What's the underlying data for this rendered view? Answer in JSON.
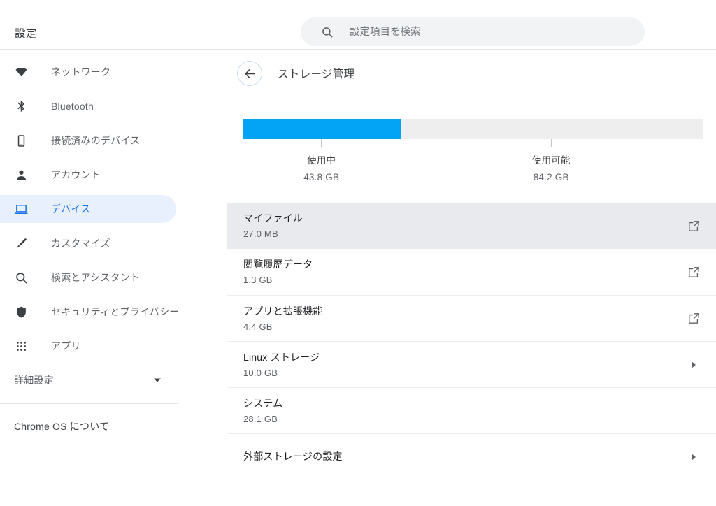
{
  "app": {
    "title": "設定"
  },
  "search": {
    "placeholder": "設定項目を検索",
    "value": "",
    "icon": "search-icon"
  },
  "sidebar": {
    "items": [
      {
        "label": "ネットワーク",
        "icon": "wifi-icon",
        "selected": false
      },
      {
        "label": "Bluetooth",
        "icon": "bluetooth-icon",
        "selected": false
      },
      {
        "label": "接続済みのデバイス",
        "icon": "phone-icon",
        "selected": false
      },
      {
        "label": "アカウント",
        "icon": "person-icon",
        "selected": false
      },
      {
        "label": "デバイス",
        "icon": "laptop-icon",
        "selected": true
      },
      {
        "label": "カスタマイズ",
        "icon": "brush-icon",
        "selected": false
      },
      {
        "label": "検索とアシスタント",
        "icon": "search-icon",
        "selected": false
      },
      {
        "label": "セキュリティとプライバシー",
        "icon": "shield-icon",
        "selected": false
      },
      {
        "label": "アプリ",
        "icon": "apps-grid-icon",
        "selected": false
      }
    ],
    "advanced": {
      "label": "詳細設定",
      "icon": "chevron-down-icon"
    },
    "about": {
      "label": "Chrome OS について"
    }
  },
  "page": {
    "title": "ストレージ管理",
    "back_icon": "arrow-back-icon"
  },
  "storage": {
    "used_percent": 34.2,
    "fill_color": "#03a3f5",
    "track_color": "#eeeeee",
    "segments": [
      {
        "name": "使用中",
        "value": "43.8 GB",
        "center_percent": 17
      },
      {
        "name": "使用可能",
        "value": "84.2 GB",
        "center_percent": 67
      }
    ]
  },
  "items": [
    {
      "title": "マイファイル",
      "size": "27.0 MB",
      "action": "open-in-new-icon",
      "highlight": true
    },
    {
      "title": "閲覧履歴データ",
      "size": "1.3 GB",
      "action": "open-in-new-icon",
      "highlight": false
    },
    {
      "title": "アプリと拡張機能",
      "size": "4.4 GB",
      "action": "open-in-new-icon",
      "highlight": false
    },
    {
      "title": "Linux ストレージ",
      "size": "10.0 GB",
      "action": "chevron-right-icon",
      "highlight": false
    },
    {
      "title": "システム",
      "size": "28.1 GB",
      "action": "none",
      "highlight": false
    },
    {
      "title": "外部ストレージの設定",
      "size": "",
      "action": "chevron-right-icon",
      "highlight": false
    }
  ]
}
